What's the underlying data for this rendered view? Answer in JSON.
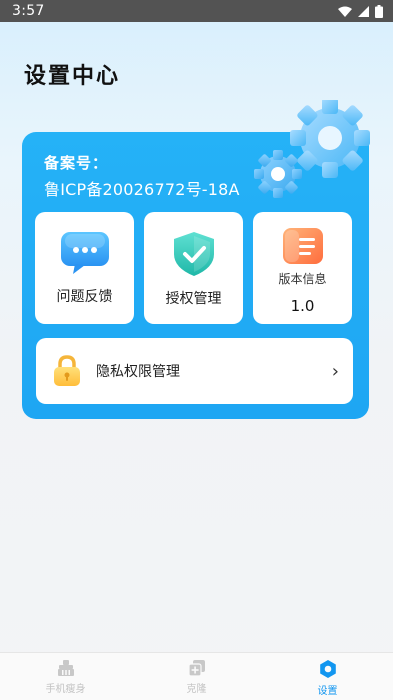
{
  "status_bar": {
    "time": "3:57",
    "icons": [
      "wifi-icon",
      "signal-icon",
      "battery-icon"
    ]
  },
  "page": {
    "title": "设置中心"
  },
  "card": {
    "icp_label": "备案号：",
    "icp_number": "鲁ICP备20026772号-18A",
    "tiles": [
      {
        "label": "问题反馈",
        "icon": "chat-bubble-icon"
      },
      {
        "label": "授权管理",
        "icon": "shield-check-icon"
      },
      {
        "label": "版本信息",
        "value": "1.0",
        "icon": "document-icon"
      }
    ],
    "privacy": {
      "label": "隐私权限管理",
      "icon": "lock-icon"
    }
  },
  "nav": {
    "items": [
      {
        "label": "手机瘦身",
        "icon": "broom-icon",
        "active": false
      },
      {
        "label": "克隆",
        "icon": "clone-icon",
        "active": false
      },
      {
        "label": "设置",
        "icon": "settings-icon",
        "active": true
      }
    ]
  },
  "colors": {
    "accent": "#1ea6f3",
    "nav_active": "#1296f0",
    "nav_inactive": "#c3c3c3",
    "status_bar": "#535353"
  }
}
